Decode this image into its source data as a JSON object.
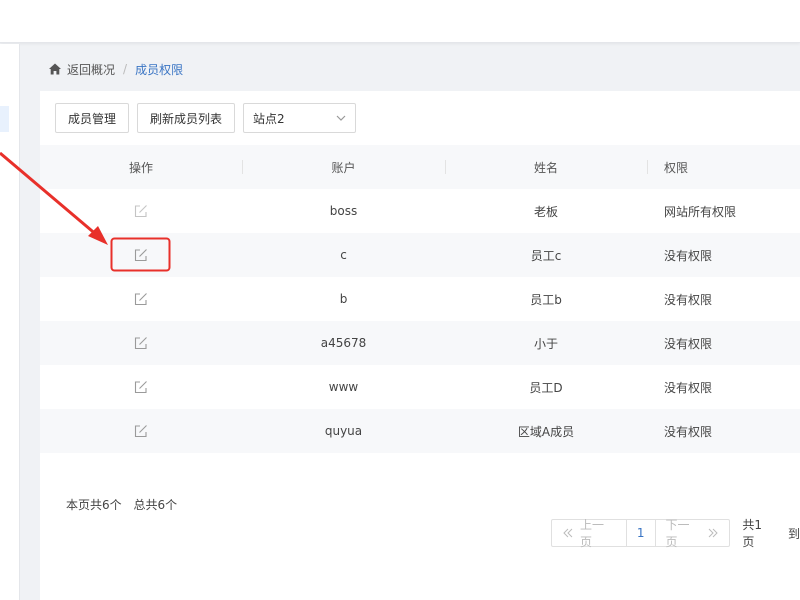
{
  "breadcrumb": {
    "back": "返回概况",
    "separator": "/",
    "current": "成员权限"
  },
  "toolbar": {
    "member_manage": "成员管理",
    "refresh_list": "刷新成员列表",
    "site_select_value": "站点2"
  },
  "table": {
    "headers": {
      "action": "操作",
      "account": "账户",
      "name": "姓名",
      "permission": "权限"
    },
    "rows": [
      {
        "account": "boss",
        "name": "老板",
        "permission": "网站所有权限"
      },
      {
        "account": "c",
        "name": "员工c",
        "permission": "没有权限"
      },
      {
        "account": "b",
        "name": "员工b",
        "permission": "没有权限"
      },
      {
        "account": "a45678",
        "name": "小于",
        "permission": "没有权限"
      },
      {
        "account": "www",
        "name": "员工D",
        "permission": "没有权限"
      },
      {
        "account": "quyua",
        "name": "区域A成员",
        "permission": "没有权限"
      }
    ]
  },
  "footer": {
    "page_count": "本页共6个",
    "total_count": "总共6个"
  },
  "pagination": {
    "prev": "上一页",
    "current_page": "1",
    "next": "下一页",
    "total_pages": "共1页",
    "goto": "到"
  },
  "colors": {
    "accent": "#3a75c4",
    "highlight": "#e8302a"
  },
  "icons": {
    "home": "home-icon",
    "edit": "edit-icon",
    "dropdown": "chevron-down-icon"
  }
}
